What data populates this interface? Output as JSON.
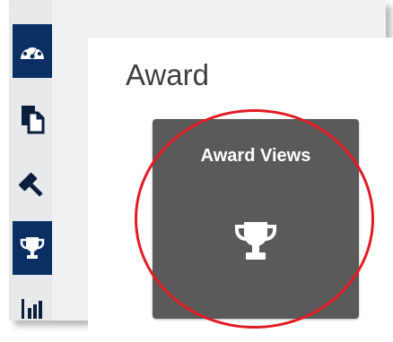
{
  "page": {
    "title": "Award"
  },
  "card": {
    "title": "Award Views",
    "icon": "trophy-icon"
  },
  "sidebar": {
    "items": [
      {
        "icon": "dashboard-icon",
        "active": true
      },
      {
        "icon": "documents-icon",
        "active": false
      },
      {
        "icon": "gavel-icon",
        "active": false
      },
      {
        "icon": "trophy-icon",
        "active": true
      },
      {
        "icon": "bar-chart-icon",
        "active": false
      }
    ]
  },
  "annotation": {
    "type": "highlight-ellipse",
    "color": "#e21b23"
  },
  "colors": {
    "sidebar_active": "#0b2f63",
    "card_bg": "#5a5a5a",
    "highlight": "#e21b23"
  }
}
